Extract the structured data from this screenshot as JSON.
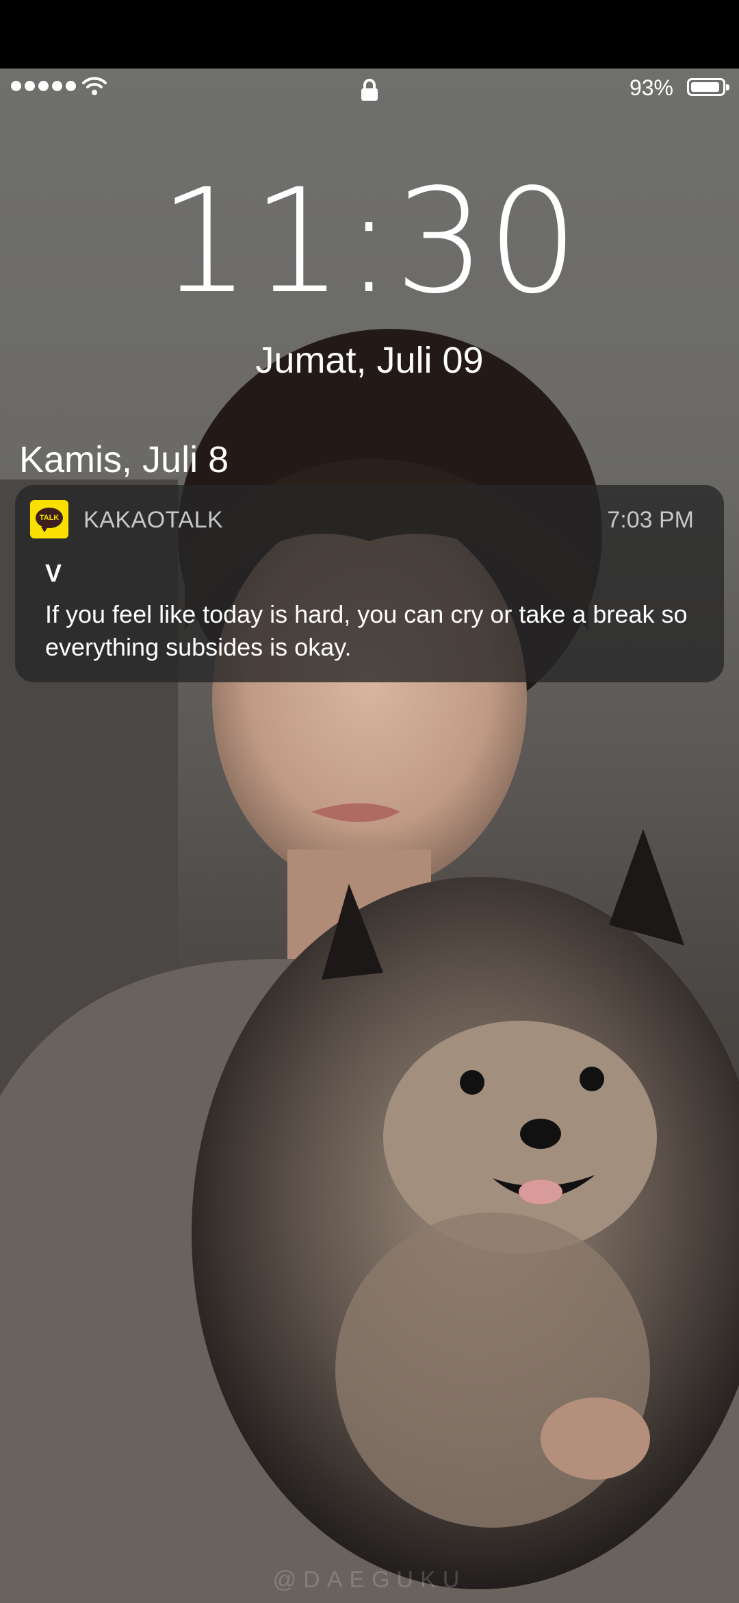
{
  "status_bar": {
    "battery_percent": "93%",
    "battery_level": 0.93
  },
  "lock_screen": {
    "time": "11:30",
    "date": "Jumat, Juli 09",
    "section_date": "Kamis, Juli 8"
  },
  "notification": {
    "app_icon_text": "TALK",
    "app_name": "KAKAOTALK",
    "time": "7:03 PM",
    "sender": "V",
    "message": "If you feel like today is hard, you can cry or take a break so everything subsides is okay."
  },
  "watermark": "@DAEGUKU",
  "colors": {
    "kakao_yellow": "#f9e000",
    "notification_bg": "#262626"
  }
}
